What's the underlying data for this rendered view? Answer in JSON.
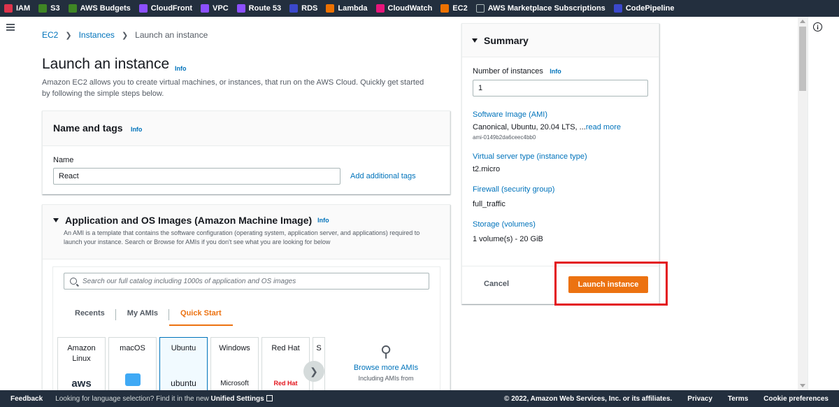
{
  "topbar": {
    "favorites": [
      {
        "label": "IAM",
        "icon": "iam-icon",
        "color": "#dd344c"
      },
      {
        "label": "S3",
        "icon": "s3-icon",
        "color": "#3f8624"
      },
      {
        "label": "AWS Budgets",
        "icon": "budgets-icon",
        "color": "#3f8624"
      },
      {
        "label": "CloudFront",
        "icon": "cloudfront-icon",
        "color": "#8c4fff"
      },
      {
        "label": "VPC",
        "icon": "vpc-icon",
        "color": "#8c4fff"
      },
      {
        "label": "Route 53",
        "icon": "route53-icon",
        "color": "#8c4fff"
      },
      {
        "label": "RDS",
        "icon": "rds-icon",
        "color": "#3b48cc"
      },
      {
        "label": "Lambda",
        "icon": "lambda-icon",
        "color": "#ed7100"
      },
      {
        "label": "CloudWatch",
        "icon": "cloudwatch-icon",
        "color": "#e7157b"
      },
      {
        "label": "EC2",
        "icon": "ec2-icon",
        "color": "#ed7100"
      },
      {
        "label": "AWS Marketplace Subscriptions",
        "icon": "marketplace-icon",
        "color": "#232f3e"
      },
      {
        "label": "CodePipeline",
        "icon": "codepipeline-icon",
        "color": "#3b48cc"
      }
    ]
  },
  "breadcrumb": {
    "items": [
      "EC2",
      "Instances"
    ],
    "current": "Launch an instance"
  },
  "page": {
    "title": "Launch an instance",
    "info": "Info",
    "description": "Amazon EC2 allows you to create virtual machines, or instances, that run on the AWS Cloud. Quickly get started by following the simple steps below."
  },
  "name_tags": {
    "title": "Name and tags",
    "info": "Info",
    "name_label": "Name",
    "name_value": "React",
    "add_tags": "Add additional tags"
  },
  "ami": {
    "title": "Application and OS Images (Amazon Machine Image)",
    "info": "Info",
    "description": "An AMI is a template that contains the software configuration (operating system, application server, and applications) required to launch your instance. Search or Browse for AMIs if you don't see what you are looking for below",
    "search_placeholder": "Search our full catalog including 1000s of application and OS images",
    "tabs": [
      "Recents",
      "My AMIs",
      "Quick Start"
    ],
    "os_options": [
      {
        "name": "Amazon Linux",
        "logo": "aws"
      },
      {
        "name": "macOS",
        "logo": ""
      },
      {
        "name": "Ubuntu",
        "logo": "ubuntu"
      },
      {
        "name": "Windows",
        "logo": "Microsoft"
      },
      {
        "name": "Red Hat",
        "logo": "Red Hat"
      },
      {
        "name": "S",
        "logo": ""
      }
    ],
    "browse_link": "Browse more AMIs",
    "browse_sub": "Including AMIs from"
  },
  "summary": {
    "title": "Summary",
    "instances_label": "Number of instances",
    "info": "Info",
    "instances_value": "1",
    "ami_label": "Software Image (AMI)",
    "ami_value": "Canonical, Ubuntu, 20.04 LTS, ...",
    "read_more": "read more",
    "ami_id": "ami-0149b2da6ceec4bb0",
    "type_label": "Virtual server type (instance type)",
    "type_value": "t2.micro",
    "firewall_label": "Firewall (security group)",
    "firewall_value": "full_traffic",
    "storage_label": "Storage (volumes)",
    "storage_value": "1 volume(s) - 20 GiB",
    "cancel": "Cancel",
    "launch": "Launch instance"
  },
  "footer": {
    "feedback": "Feedback",
    "lang_text": "Looking for language selection? Find it in the new ",
    "unified": "Unified Settings",
    "copyright": "© 2022, Amazon Web Services, Inc. or its affiliates.",
    "privacy": "Privacy",
    "terms": "Terms",
    "cookies": "Cookie preferences"
  }
}
